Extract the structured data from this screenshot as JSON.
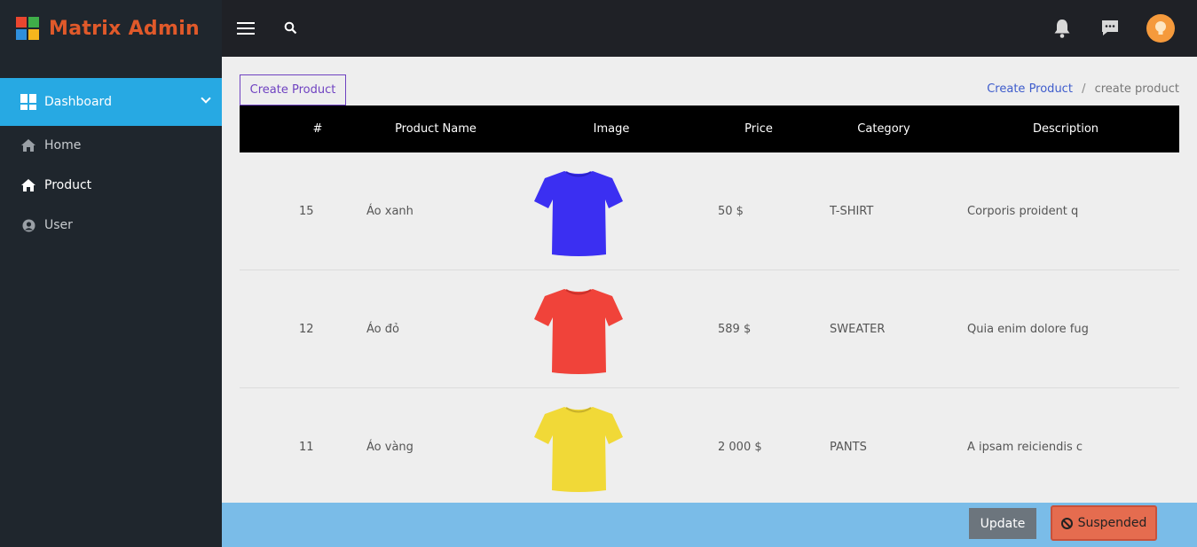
{
  "app": {
    "title": "Matrix Admin"
  },
  "sidebar": {
    "active": {
      "label": "Dashboard"
    },
    "items": [
      {
        "label": "Home",
        "icon": "home-icon"
      },
      {
        "label": "Product",
        "icon": "home-icon"
      },
      {
        "label": "User",
        "icon": "user-circle-icon"
      }
    ]
  },
  "topbar": {
    "icons": [
      "hamburger-icon",
      "search-icon",
      "bell-icon",
      "chat-icon",
      "avatar"
    ]
  },
  "content": {
    "create_button": "Create Product",
    "breadcrumb": {
      "link": "Create Product",
      "separator": "/",
      "current": "create product"
    }
  },
  "table": {
    "headers": [
      "#",
      "Product Name",
      "Image",
      "Price",
      "Category",
      "Description"
    ],
    "rows": [
      {
        "id": "15",
        "name": "Áo xanh",
        "image_color": "#3b2ff2",
        "price": "50 $",
        "category": "T-SHIRT",
        "description": "Corporis proident q"
      },
      {
        "id": "12",
        "name": "Áo đỏ",
        "image_color": "#f0433a",
        "price": "589 $",
        "category": "SWEATER",
        "description": "Quia enim dolore fug"
      },
      {
        "id": "11",
        "name": "Áo vàng",
        "image_color": "#f1d937",
        "price": "2 000 $",
        "category": "PANTS",
        "description": "A ipsam reiciendis c"
      }
    ]
  },
  "footer": {
    "update": "Update",
    "suspended": "Suspended"
  },
  "colors": {
    "sidebar_bg": "#1f262d",
    "topbar_bg": "#1f2126",
    "active_nav": "#27a9e3",
    "brand": "#e0592a",
    "footer_bg": "#7abce8",
    "suspended": "#e56c4f"
  }
}
